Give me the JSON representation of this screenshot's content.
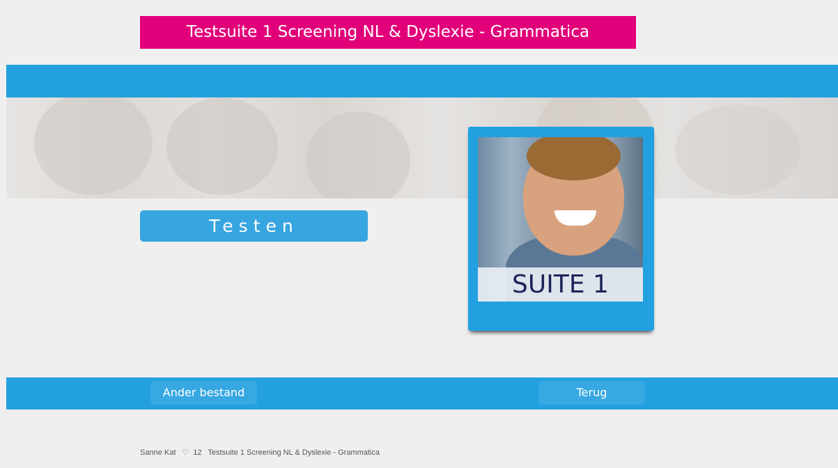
{
  "header": {
    "title": "Testsuite 1 Screening NL & Dyslexie - Grammatica"
  },
  "main": {
    "start_button_label": "Testen",
    "suite_card": {
      "label": "SUITE 1"
    }
  },
  "nav": {
    "other_file_label": "Ander bestand",
    "back_label": "Terug"
  },
  "footer": {
    "user": "Sanne Kat",
    "heart_icon": "♡",
    "likes": "12",
    "suite_name": "Testsuite 1 Screening NL & Dyslexie - Grammatica"
  },
  "colors": {
    "accent_magenta": "#e2007a",
    "accent_blue": "#22a0df",
    "button_blue": "#37a5e0",
    "background": "#efefef",
    "suite_label_text": "#1c2559"
  },
  "icons": {
    "likes_icon": "heart-icon"
  }
}
